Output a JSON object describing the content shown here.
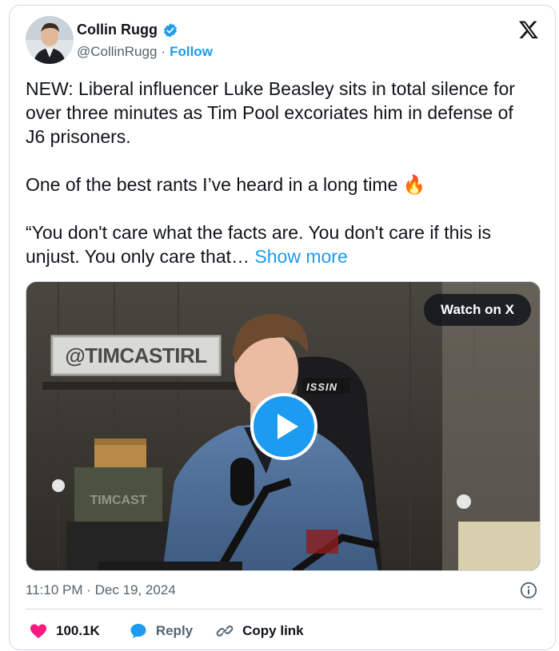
{
  "author": {
    "name": "Collin Rugg",
    "handle": "@CollinRugg",
    "separator": "·",
    "follow_label": "Follow"
  },
  "tweet": {
    "paragraphs": [
      "NEW: Liberal influencer Luke Beasley sits in total silence for over three minutes as Tim Pool excoriates him in defense of J6 prisoners.",
      "One of the best rants I’ve heard in a long time 🔥",
      "“You don't care what the facts are. You don't care if this is unjust. You only care that…"
    ],
    "show_more_label": "Show more"
  },
  "media": {
    "watch_label": "Watch on X",
    "sign_text": "@TIMCASTIRL",
    "box_text": "TIMCAST",
    "chair_text": "ISSIN"
  },
  "timestamp": "11:10 PM · Dec 19, 2024",
  "actions": {
    "likes": "100.1K",
    "reply_label": "Reply",
    "copy_label": "Copy link"
  },
  "colors": {
    "accent": "#1d9bf0",
    "like": "#f91880",
    "text": "#0f1419",
    "muted": "#536471",
    "border": "#cfd9de"
  },
  "icons": [
    "verified-badge-icon",
    "x-logo-icon",
    "play-icon",
    "info-icon",
    "heart-icon",
    "reply-bubble-icon",
    "link-icon"
  ]
}
